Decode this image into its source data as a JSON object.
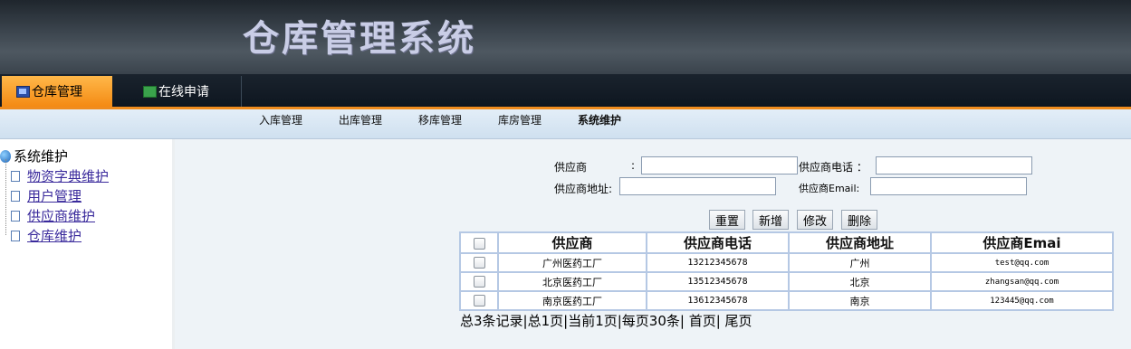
{
  "app": {
    "title": "仓库管理系统"
  },
  "nav": {
    "tabs": [
      {
        "label": "仓库管理",
        "icon": "monitor-icon",
        "active": true
      },
      {
        "label": "在线申请",
        "icon": "book-icon",
        "active": false
      }
    ],
    "accent_color": "#f08c1e"
  },
  "subnav": {
    "items": [
      "入库管理",
      "出库管理",
      "移库管理",
      "库房管理",
      "系统维护"
    ]
  },
  "sidebar": {
    "root": "系统维护",
    "items": [
      "物资字典维护",
      "用户管理",
      "供应商维护",
      "仓库维护"
    ]
  },
  "form": {
    "supplier_label": "供应商",
    "colon": ":",
    "phone_label": "供应商电话 ：",
    "address_label": "供应商地址:",
    "email_label": "供应商Email:",
    "supplier_value": "",
    "phone_value": "",
    "address_value": "",
    "email_value": ""
  },
  "buttons": {
    "reset": "重置",
    "add": "新增",
    "edit": "修改",
    "delete": "删除"
  },
  "table": {
    "headers": [
      "供应商",
      "供应商电话",
      "供应商地址",
      "供应商Emai"
    ],
    "rows": [
      {
        "name": "广州医药工厂",
        "phone": "13212345678",
        "address": "广州",
        "email": "test@qq.com"
      },
      {
        "name": "北京医药工厂",
        "phone": "13512345678",
        "address": "北京",
        "email": "zhangsan@qq.com"
      },
      {
        "name": "南京医药工厂",
        "phone": "13612345678",
        "address": "南京",
        "email": "123445@qq.com"
      }
    ]
  },
  "pager": {
    "text": "总3条记录|总1页|当前1页|每页30条|  首页|  尾页"
  }
}
